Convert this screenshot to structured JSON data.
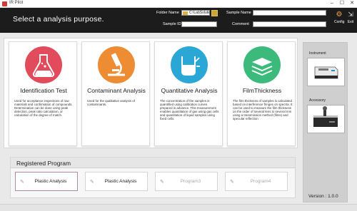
{
  "window": {
    "title": "IR Pilot",
    "minimize": "–",
    "restore": "☐",
    "close": "✕"
  },
  "header": {
    "purpose_prompt": "Select a analysis purpose.",
    "folder_name_label": "Folder Name",
    "folder_name_value": "C:\\LabSolutions\\I",
    "sample_name_label": "Sample Name",
    "sample_name_value": "",
    "sample_id_label": "Sample ID",
    "sample_id_value": "",
    "comment_label": "Comment",
    "comment_value": "",
    "config_label": "Config",
    "exit_label": "Exit"
  },
  "cards": [
    {
      "title": "Identification Test",
      "description": "Used for acceptance inspections of raw materials and confirmation of compounds. Determination can be done using peak detection, peak ratio calculation, or calculation of the degree of match.",
      "color": "#e24b5b",
      "icon": "flask-icon"
    },
    {
      "title": "Contaminant Analysis",
      "description": "Used for the qualitative analysis of contaminants.",
      "color": "#ee8c33",
      "icon": "microscope-icon"
    },
    {
      "title": "Quantitative Analysis",
      "description": "The concentration of the samples is quantified using calibration curves prepared in advance. This measurement enables quantitation of gas using gas cells and quantitation of liquid samples using fixed cells.",
      "color": "#2ba7d6",
      "icon": "beaker-icon"
    },
    {
      "title": "FilmThickness",
      "description": "The film thickness of samples is calculated based on interference fringes on spectra. It can be used to measure the film thickness on the order of several tens to several mm using a transmission method (films) and specular reflection",
      "color": "#3cba7c",
      "icon": "film-layers-icon"
    }
  ],
  "registered": {
    "title": "Registered Program",
    "programs": [
      {
        "label": "Plastic Analysis"
      },
      {
        "label": "Plastic Analysis"
      },
      {
        "label": "Program3"
      },
      {
        "label": "Program4"
      }
    ]
  },
  "side": {
    "instrument_label": "Instrument",
    "accessory_label": "Accessory",
    "version_label": "Version : 1.0.0"
  }
}
